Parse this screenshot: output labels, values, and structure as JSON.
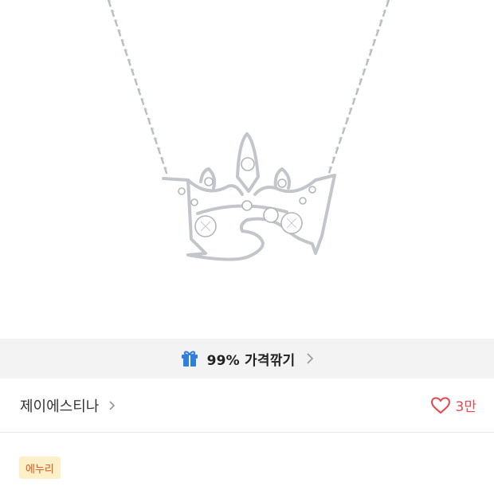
{
  "product_image": {
    "icon": "crown-necklace-image"
  },
  "promo": {
    "label": "99% 가격깎기",
    "icon": "gift-icon",
    "accent": "#2f7fe0"
  },
  "seller": {
    "name": "제이에스티나"
  },
  "like": {
    "count": "3만",
    "icon": "heart-outline-icon",
    "color": "#e5484d"
  },
  "badge": {
    "label": "에누리"
  },
  "colors": {
    "promo_bg": "#f3f3f3",
    "badge_bg": "#fdf0c8",
    "badge_text": "#d9561a"
  }
}
